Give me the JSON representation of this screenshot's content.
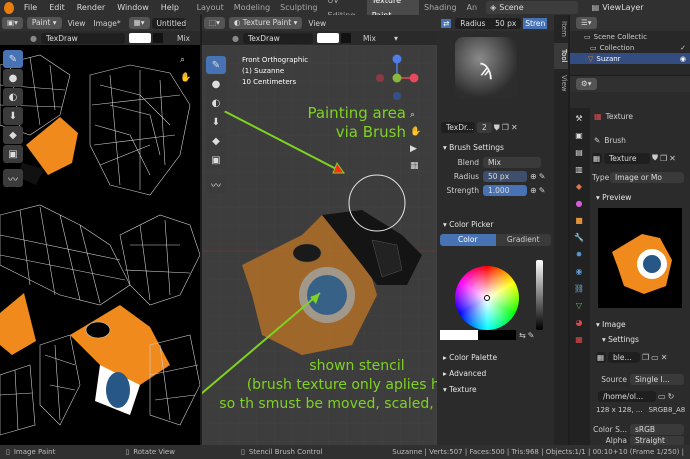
{
  "topbar": {
    "menus": [
      "File",
      "Edit",
      "Render",
      "Window",
      "Help"
    ],
    "tabs": [
      "Layout",
      "Modeling",
      "Sculpting",
      "UV Editing",
      "Texture Paint",
      "Shading",
      "An"
    ],
    "active_tab": "Texture Paint",
    "scene_label": "Scene",
    "viewlayer_label": "ViewLayer"
  },
  "left_editor": {
    "mode": "Paint",
    "view_menu": "View",
    "image_menu": "Image*",
    "image_name": "Untitled",
    "brush": "TexDraw",
    "blend": "Mix"
  },
  "viewport": {
    "mode": "Texture Paint",
    "view_menu": "View",
    "brush": "TexDraw",
    "blend": "Mix",
    "radius_label": "Radius",
    "radius_value": "50 px",
    "strength_short": "Stren",
    "overlay_lines": [
      "Front Orthographic",
      "(1) Suzanne",
      "10 Centimeters"
    ]
  },
  "annotations": {
    "painting_line1": "Painting area",
    "painting_line2": "via Brush",
    "stencil_line1": "shown stencil",
    "stencil_line2": "(brush texture only aplies here;",
    "stencil_line3": "so th  smust be moved, scaled, rotated)"
  },
  "tool_settings": {
    "brush_name": "TexDr...",
    "brush_users": "2",
    "sections": {
      "brush_settings": "Brush Settings",
      "color_picker": "Color Picker",
      "color_palette": "Color Palette",
      "advanced": "Advanced",
      "texture": "Texture"
    },
    "blend_label": "Blend",
    "blend_value": "Mix",
    "radius_label": "Radius",
    "radius_value": "50 px",
    "strength_label": "Strength",
    "strength_value": "1.000",
    "color_tab": "Color",
    "gradient_tab": "Gradient",
    "side_tabs": [
      "Item",
      "Tool",
      "View"
    ]
  },
  "outliner": {
    "root": "Scene Collectic",
    "collection": "Collection",
    "object": "Suzanr"
  },
  "properties": {
    "texture_header": "Texture",
    "brush_label": "Brush",
    "texture_field": "Texture",
    "type_label": "Type",
    "type_value": "Image or Mo",
    "preview_section": "Preview",
    "image_section": "Image",
    "settings_label": "Settings",
    "image_name": "ble...",
    "source_label": "Source",
    "source_value": "Single I...",
    "filepath": "/home/ol...",
    "image_info1": "128 x 128, ...",
    "image_info2": "SRGB8_A8",
    "colorspace_label": "Color S...",
    "colorspace_value": "sRGB",
    "alpha_label": "Alpha",
    "alpha_value": "Straight"
  },
  "statusbar": {
    "image_paint": "Image Paint",
    "rotate_view": "Rotate View",
    "stencil_control": "Stencil Brush Control",
    "stats": "Suzanne | Verts:507 | Faces:500 | Tris:968 | Objects:1/1 | 00:10+10 (Frame 1/250) |"
  },
  "colors": {
    "accent_blue": "#4772b3",
    "annotation_green": "#7ed321",
    "suzanne_orange": "#f08a1c",
    "blender_logo_blue": "#265787"
  }
}
